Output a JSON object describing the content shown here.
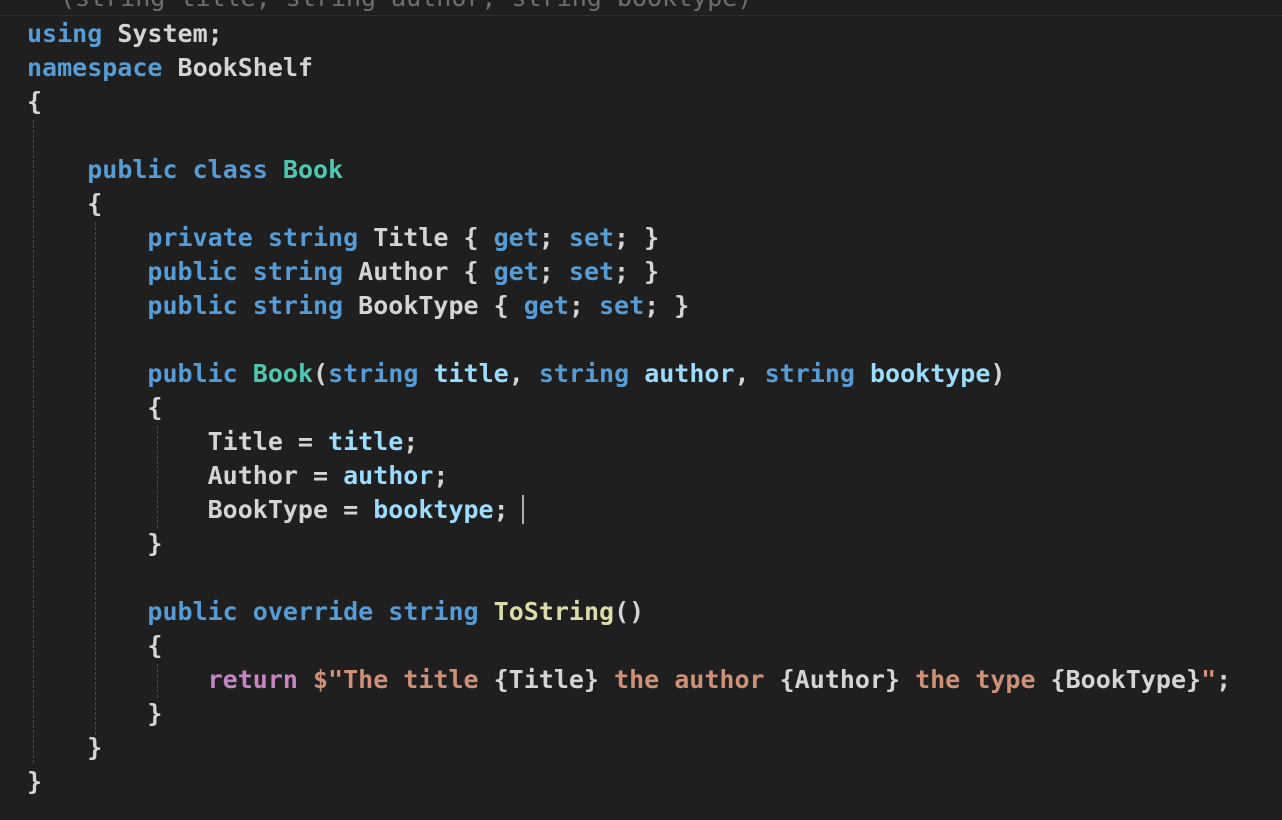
{
  "window": {
    "top_fragment": "(string title, string author, string booktype)"
  },
  "colors": {
    "background": "#1f1f1f",
    "keyword": "#569cd6",
    "control_keyword": "#c586c0",
    "type_name": "#4ec9b0",
    "function_name": "#dcdcaa",
    "parameter": "#9cdcfe",
    "string": "#ce9178",
    "default_text": "#d4d4d4",
    "indent_guide": "#4a4a4a",
    "cursor": "#aeafad"
  },
  "code": {
    "language": "csharp",
    "lines": [
      [
        {
          "t": "using",
          "c": "kw"
        },
        {
          "t": " System;",
          "c": "plain"
        }
      ],
      [
        {
          "t": "namespace",
          "c": "kw"
        },
        {
          "t": " BookShelf",
          "c": "plain"
        }
      ],
      [
        {
          "t": "{",
          "c": "plain"
        }
      ],
      [],
      [
        {
          "t": "    ",
          "c": "plain"
        },
        {
          "t": "public",
          "c": "kw"
        },
        {
          "t": " ",
          "c": "plain"
        },
        {
          "t": "class",
          "c": "kw"
        },
        {
          "t": " ",
          "c": "plain"
        },
        {
          "t": "Book",
          "c": "type"
        }
      ],
      [
        {
          "t": "    {",
          "c": "plain"
        }
      ],
      [
        {
          "t": "        ",
          "c": "plain"
        },
        {
          "t": "private",
          "c": "kw"
        },
        {
          "t": " ",
          "c": "plain"
        },
        {
          "t": "string",
          "c": "kw"
        },
        {
          "t": " Title { ",
          "c": "plain"
        },
        {
          "t": "get",
          "c": "kw"
        },
        {
          "t": "; ",
          "c": "plain"
        },
        {
          "t": "set",
          "c": "kw"
        },
        {
          "t": "; }",
          "c": "plain"
        }
      ],
      [
        {
          "t": "        ",
          "c": "plain"
        },
        {
          "t": "public",
          "c": "kw"
        },
        {
          "t": " ",
          "c": "plain"
        },
        {
          "t": "string",
          "c": "kw"
        },
        {
          "t": " Author { ",
          "c": "plain"
        },
        {
          "t": "get",
          "c": "kw"
        },
        {
          "t": "; ",
          "c": "plain"
        },
        {
          "t": "set",
          "c": "kw"
        },
        {
          "t": "; }",
          "c": "plain"
        }
      ],
      [
        {
          "t": "        ",
          "c": "plain"
        },
        {
          "t": "public",
          "c": "kw"
        },
        {
          "t": " ",
          "c": "plain"
        },
        {
          "t": "string",
          "c": "kw"
        },
        {
          "t": " BookType { ",
          "c": "plain"
        },
        {
          "t": "get",
          "c": "kw"
        },
        {
          "t": "; ",
          "c": "plain"
        },
        {
          "t": "set",
          "c": "kw"
        },
        {
          "t": "; }",
          "c": "plain"
        }
      ],
      [],
      [
        {
          "t": "        ",
          "c": "plain"
        },
        {
          "t": "public",
          "c": "kw"
        },
        {
          "t": " ",
          "c": "plain"
        },
        {
          "t": "Book",
          "c": "type"
        },
        {
          "t": "(",
          "c": "plain"
        },
        {
          "t": "string",
          "c": "kw"
        },
        {
          "t": " ",
          "c": "plain"
        },
        {
          "t": "title",
          "c": "par"
        },
        {
          "t": ", ",
          "c": "plain"
        },
        {
          "t": "string",
          "c": "kw"
        },
        {
          "t": " ",
          "c": "plain"
        },
        {
          "t": "author",
          "c": "par"
        },
        {
          "t": ", ",
          "c": "plain"
        },
        {
          "t": "string",
          "c": "kw"
        },
        {
          "t": " ",
          "c": "plain"
        },
        {
          "t": "booktype",
          "c": "par"
        },
        {
          "t": ")",
          "c": "plain"
        }
      ],
      [
        {
          "t": "        {",
          "c": "plain"
        }
      ],
      [
        {
          "t": "            Title = ",
          "c": "plain"
        },
        {
          "t": "title",
          "c": "par"
        },
        {
          "t": ";",
          "c": "plain"
        }
      ],
      [
        {
          "t": "            Author = ",
          "c": "plain"
        },
        {
          "t": "author",
          "c": "par"
        },
        {
          "t": ";",
          "c": "plain"
        }
      ],
      [
        {
          "t": "            BookType = ",
          "c": "plain"
        },
        {
          "t": "booktype",
          "c": "par"
        },
        {
          "t": ";",
          "c": "plain"
        }
      ],
      [
        {
          "t": "        }",
          "c": "plain"
        }
      ],
      [],
      [
        {
          "t": "        ",
          "c": "plain"
        },
        {
          "t": "public",
          "c": "kw"
        },
        {
          "t": " ",
          "c": "plain"
        },
        {
          "t": "override",
          "c": "kw"
        },
        {
          "t": " ",
          "c": "plain"
        },
        {
          "t": "string",
          "c": "kw"
        },
        {
          "t": " ",
          "c": "plain"
        },
        {
          "t": "ToString",
          "c": "fn"
        },
        {
          "t": "()",
          "c": "plain"
        }
      ],
      [
        {
          "t": "        {",
          "c": "plain"
        }
      ],
      [
        {
          "t": "            ",
          "c": "plain"
        },
        {
          "t": "return",
          "c": "ctl"
        },
        {
          "t": " ",
          "c": "plain"
        },
        {
          "t": "$\"The title ",
          "c": "str"
        },
        {
          "t": "{Title}",
          "c": "plain"
        },
        {
          "t": " the author ",
          "c": "str"
        },
        {
          "t": "{Author}",
          "c": "plain"
        },
        {
          "t": " the type ",
          "c": "str"
        },
        {
          "t": "{BookType}",
          "c": "plain"
        },
        {
          "t": "\"",
          "c": "str"
        },
        {
          "t": ";",
          "c": "plain"
        }
      ],
      [
        {
          "t": "        }",
          "c": "plain"
        }
      ],
      [
        {
          "t": "    }",
          "c": "plain"
        }
      ],
      [
        {
          "t": "}",
          "c": "plain"
        }
      ]
    ]
  }
}
